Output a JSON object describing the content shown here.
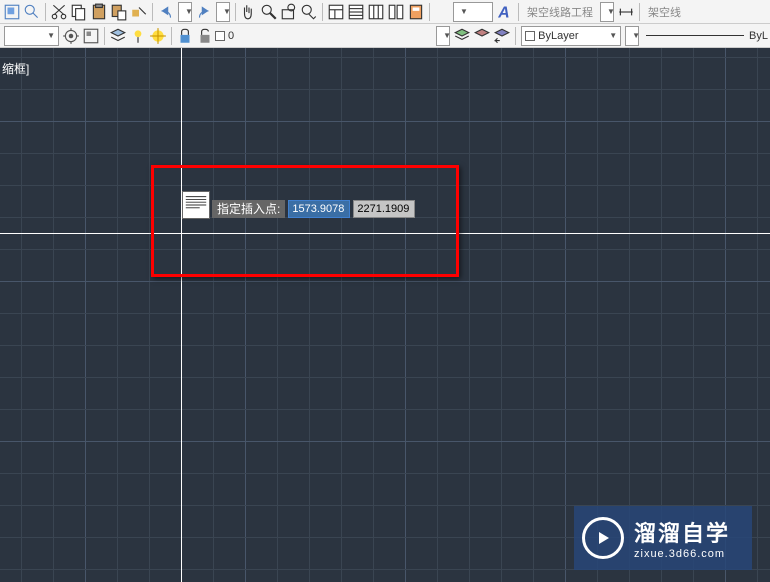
{
  "toolbar1": {
    "dropdown1": "",
    "text1": "架空线路工程",
    "text2": "架空线"
  },
  "toolbar2": {
    "layer_name": "0",
    "linetype": "ByLayer",
    "lineweight": "ByL"
  },
  "viewport": {
    "corner_text": "缩框]"
  },
  "command": {
    "prompt": "指定插入点:",
    "coord_x": "1573.9078",
    "coord_y": "2271.1909"
  },
  "watermark": {
    "title": "溜溜自学",
    "url": "zixue.3d66.com"
  }
}
